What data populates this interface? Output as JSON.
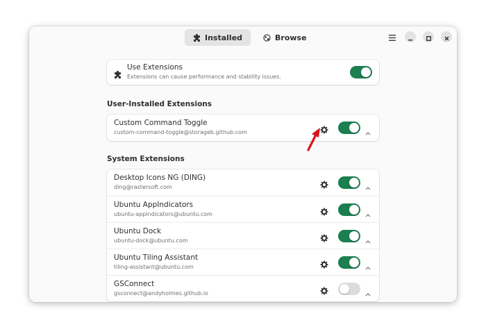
{
  "colors": {
    "accent": "#1b7f4f",
    "toggle_off": "#dcdcdc",
    "annotation_arrow": "#d8141b"
  },
  "header": {
    "tabs": [
      {
        "label": "Installed",
        "icon": "puzzle-icon",
        "active": true
      },
      {
        "label": "Browse",
        "icon": "globe-icon",
        "active": false
      }
    ],
    "controls": [
      "menu-icon",
      "minimize-icon",
      "maximize-icon",
      "close-icon"
    ]
  },
  "master": {
    "title": "Use Extensions",
    "subtitle": "Extensions can cause performance and stability issues.",
    "enabled": true,
    "icon": "puzzle-icon"
  },
  "user_section": {
    "title": "User-Installed Extensions",
    "items": [
      {
        "name": "Custom Command Toggle",
        "id": "custom-command-toggle@storageb.github.com",
        "enabled": true
      }
    ]
  },
  "system_section": {
    "title": "System Extensions",
    "items": [
      {
        "name": "Desktop Icons NG (DING)",
        "id": "ding@rastersoft.com",
        "enabled": true
      },
      {
        "name": "Ubuntu AppIndicators",
        "id": "ubuntu-appindicators@ubuntu.com",
        "enabled": true
      },
      {
        "name": "Ubuntu Dock",
        "id": "ubuntu-dock@ubuntu.com",
        "enabled": true
      },
      {
        "name": "Ubuntu Tiling Assistant",
        "id": "tiling-assistant@ubuntu.com",
        "enabled": true
      },
      {
        "name": "GSConnect",
        "id": "gsconnect@andyholmes.github.io",
        "enabled": false
      }
    ]
  }
}
